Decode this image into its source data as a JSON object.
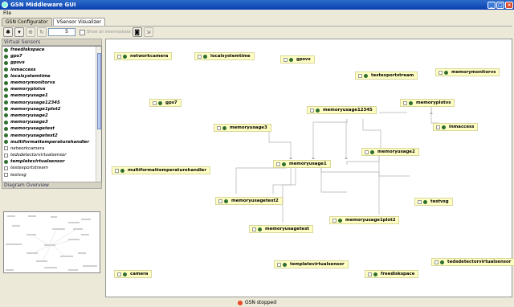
{
  "window": {
    "title": "GSN Middleware GUI",
    "minimize": "_",
    "maximize": "□",
    "close": "×"
  },
  "menu": {
    "file": "File"
  },
  "tabs": [
    {
      "label": "GSN Configurator"
    },
    {
      "label": "VSensor Visualizer"
    }
  ],
  "toolbar": {
    "spinner_value": "5",
    "checkbox_label": "Show all intermediate"
  },
  "left": {
    "sensors_title": "Virtual Sensors",
    "overview_title": "Diagram Overview",
    "sensors": [
      {
        "label": "freediskspace"
      },
      {
        "label": "gps7"
      },
      {
        "label": "gpsvs"
      },
      {
        "label": "inmaccess"
      },
      {
        "label": "localsystemtime"
      },
      {
        "label": "memorymonitorvs"
      },
      {
        "label": "memoryplotvs"
      },
      {
        "label": "memoryusage1"
      },
      {
        "label": "memoryusage12345"
      },
      {
        "label": "memoryusage1plot2"
      },
      {
        "label": "memoryusage2"
      },
      {
        "label": "memoryusage3"
      },
      {
        "label": "memoryusagetest"
      },
      {
        "label": "memoryusagetest2"
      },
      {
        "label": "multiformattemperaturehandler"
      },
      {
        "label": "networkcamera"
      },
      {
        "label": "tedsdetectorvirtualsensor"
      },
      {
        "label": "templatevirtualsensor"
      },
      {
        "label": "testexportstream"
      },
      {
        "label": "testvsg"
      }
    ]
  },
  "graph": {
    "nodes": {
      "networkcamera": "networkcamera",
      "localsystemtime": "localsystemtime",
      "gpsvs": "gpsvs",
      "testexportstream": "testexportstream",
      "memorymonitorvs": "memorymonitorvs",
      "gps7": "gps7",
      "memoryusage12345": "memoryusage12345",
      "memoryplotvs": "memoryplotvs",
      "memoryusage3": "memoryusage3",
      "inmaccess": "inmaccess",
      "memoryusage2": "memoryusage2",
      "multiformattemperaturehandler": "multiformattemperaturehandler",
      "memoryusage1": "memoryusage1",
      "memoryusagetest2": "memoryusagetest2",
      "testvsg": "testvsg",
      "memoryusage1plot2": "memoryusage1plot2",
      "memoryusagetest": "memoryusagetest",
      "camera": "camera",
      "templatevirtualsensor": "templatevirtualsensor",
      "freediskspace": "freediskspace",
      "tedsdetectorvirtualsensor": "tedsdetectorvirtualsensor"
    }
  },
  "status": {
    "text": "GSN stopped",
    "color": "#e84a2a"
  },
  "colors": {
    "node_fill": "#ffffc4",
    "node_icon": "#2f6f2f",
    "titlebar": "#0a3fb0"
  }
}
